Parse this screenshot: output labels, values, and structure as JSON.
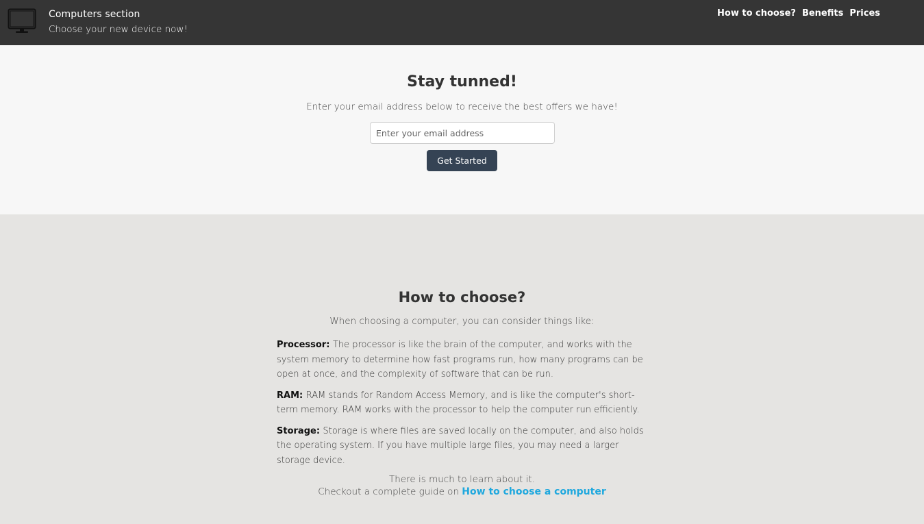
{
  "header": {
    "title": "Computers section",
    "subtitle": "Choose your new device now!",
    "logo_icon": "monitor-icon",
    "nav": [
      {
        "label": "How to choose?"
      },
      {
        "label": "Benefits"
      },
      {
        "label": "Prices"
      }
    ]
  },
  "signup": {
    "heading": "Stay tunned!",
    "description": "Enter your email address below to receive the best offers we have!",
    "email_placeholder": "Enter your email address",
    "email_value": "",
    "button_label": "Get Started",
    "button_color": "#354354"
  },
  "choose": {
    "heading": "How to choose?",
    "intro": "When choosing a computer, you can consider things like:",
    "items": [
      {
        "term": "Processor:",
        "text": "The processor is like the brain of the computer, and works with the system memory to determine how fast programs run, how many programs can be open at once, and the complexity of software that can be run."
      },
      {
        "term": "RAM:",
        "text": "RAM stands for Random Access Memory, and is like the computer's short-term memory. RAM works with the processor to help the computer run efficiently."
      },
      {
        "term": "Storage:",
        "text": "Storage is where files are saved locally on the computer, and also holds the operating system. If you have multiple large files, you may need a larger storage device."
      }
    ],
    "outro_line1": "There is much to learn about it.",
    "outro_line2": "Checkout a complete guide on",
    "guide_link": "How to choose a computer",
    "link_color": "#1fa8de"
  }
}
